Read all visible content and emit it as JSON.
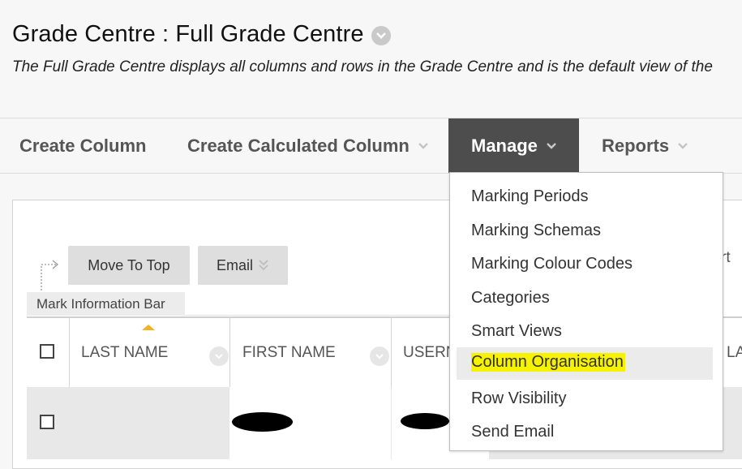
{
  "page": {
    "title": "Grade Centre : Full Grade Centre",
    "subtitle": "The Full Grade Centre displays all columns and rows in the Grade Centre and is the default view of the"
  },
  "toolbar": {
    "items": [
      {
        "label": "Create Column"
      },
      {
        "label": "Create Calculated Column"
      },
      {
        "label": "Manage"
      },
      {
        "label": "Reports"
      }
    ]
  },
  "actions": {
    "move_to_top": "Move To Top",
    "email": "Email"
  },
  "mark_information_bar": "Mark Information Bar",
  "grid": {
    "columns": [
      "LAST NAME",
      "FIRST NAME",
      "USERN"
    ],
    "right_fragments": {
      "top": "rt",
      "header": "LA"
    }
  },
  "manage_menu": {
    "items": [
      "Marking Periods",
      "Marking Schemas",
      "Marking Colour Codes",
      "Categories",
      "Smart Views",
      "Column Organisation",
      "Row Visibility",
      "Send Email"
    ],
    "highlighted": "Column Organisation"
  },
  "colors": {
    "active_menu_bg": "#4d4d4d",
    "highlight": "#f6f200",
    "sort_arrow": "#f0b323"
  }
}
